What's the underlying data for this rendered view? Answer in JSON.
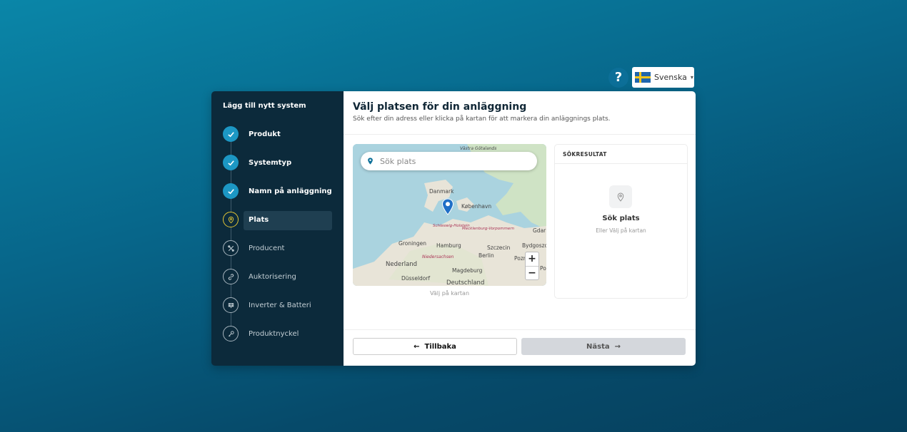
{
  "header": {
    "help_icon": "question-icon",
    "language": {
      "label": "Svenska",
      "flag": "sweden-flag"
    }
  },
  "sidebar": {
    "title": "Lägg till nytt system",
    "steps": [
      {
        "label": "Produkt",
        "state": "done",
        "icon": "check-icon"
      },
      {
        "label": "Systemtyp",
        "state": "done",
        "icon": "check-icon"
      },
      {
        "label": "Namn på anläggning",
        "state": "done",
        "icon": "check-icon"
      },
      {
        "label": "Plats",
        "state": "active",
        "icon": "location-pin-icon"
      },
      {
        "label": "Producent",
        "state": "todo",
        "icon": "tools-icon"
      },
      {
        "label": "Auktorisering",
        "state": "todo",
        "icon": "link-icon"
      },
      {
        "label": "Inverter & Batteri",
        "state": "todo",
        "icon": "grid-icon"
      },
      {
        "label": "Produktnyckel",
        "state": "todo",
        "icon": "key-icon"
      }
    ]
  },
  "main": {
    "title": "Välj platsen för din anläggning",
    "subtitle": "Sök efter din adress eller klicka på kartan för att markera din anläggnings plats.",
    "search": {
      "placeholder": "Sök plats"
    },
    "map": {
      "caption": "Välj på kartan",
      "labels": {
        "danmark": "Danmark",
        "kobenhavn": "København",
        "hamburg": "Hamburg",
        "groningen": "Groningen",
        "berlin": "Berlin",
        "szczecin": "Szczecin",
        "bydgoszcz": "Bydgoszc",
        "nederland": "Nederland",
        "magdeburg": "Magdeburg",
        "dusseldorf": "Düsseldorf",
        "deutschland": "Deutschland",
        "gdansk": "Gdar",
        "poznan": "Pozr",
        "po": "Po",
        "schleswig": "Schleswig-Holstein",
        "mecklenburg": "Mecklenburg-Vorpommern",
        "niedersachsen": "Niedersachsen",
        "vastra": "Västra Götalands"
      },
      "zoom_in": "+",
      "zoom_out": "−"
    },
    "results": {
      "header": "SÖKRESULTAT",
      "title": "Sök plats",
      "subtitle": "Eller Välj på kartan"
    }
  },
  "footer": {
    "back_label": "Tillbaka",
    "next_label": "Nästa"
  },
  "colors": {
    "accent": "#1c97c4",
    "sidebar_bg": "#0c2a3b",
    "active_ring": "#e2c536"
  }
}
